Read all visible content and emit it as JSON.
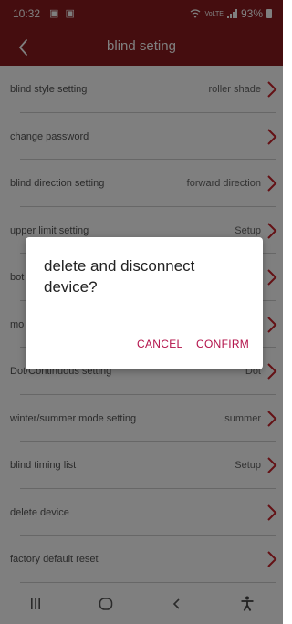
{
  "status_bar": {
    "time": "10:32",
    "notifications": "▣ ▣",
    "network": "VoLTE",
    "battery": "93%"
  },
  "header": {
    "back_icon": "chevron-left-icon",
    "title": "blind seting"
  },
  "settings": [
    {
      "label": "blind style setting",
      "value": "roller shade"
    },
    {
      "label": "change password",
      "value": ""
    },
    {
      "label": "blind direction setting",
      "value": "forward direction"
    },
    {
      "label": "upper limit setting",
      "value": "Setup"
    },
    {
      "label": "bot",
      "value": ""
    },
    {
      "label": "mo",
      "value": ""
    },
    {
      "label": "Dot/Continuous setting",
      "value": "Dot"
    },
    {
      "label": "winter/summer mode setting",
      "value": "summer"
    },
    {
      "label": "blind timing list",
      "value": "Setup"
    },
    {
      "label": "delete device",
      "value": ""
    },
    {
      "label": "factory default reset",
      "value": ""
    }
  ],
  "dialog": {
    "message": "delete and disconnect device?",
    "cancel_label": "CANCEL",
    "confirm_label": "CONFIRM"
  },
  "bottom_nav": {
    "icons": [
      "recents-icon",
      "home-icon",
      "back-icon",
      "accessibility-icon"
    ]
  },
  "colors": {
    "header_bg": "#8b1a1e",
    "chevron": "#c8232b",
    "dialog_button": "#b3124a",
    "overlay": "rgba(0,0,0,0.5)"
  }
}
